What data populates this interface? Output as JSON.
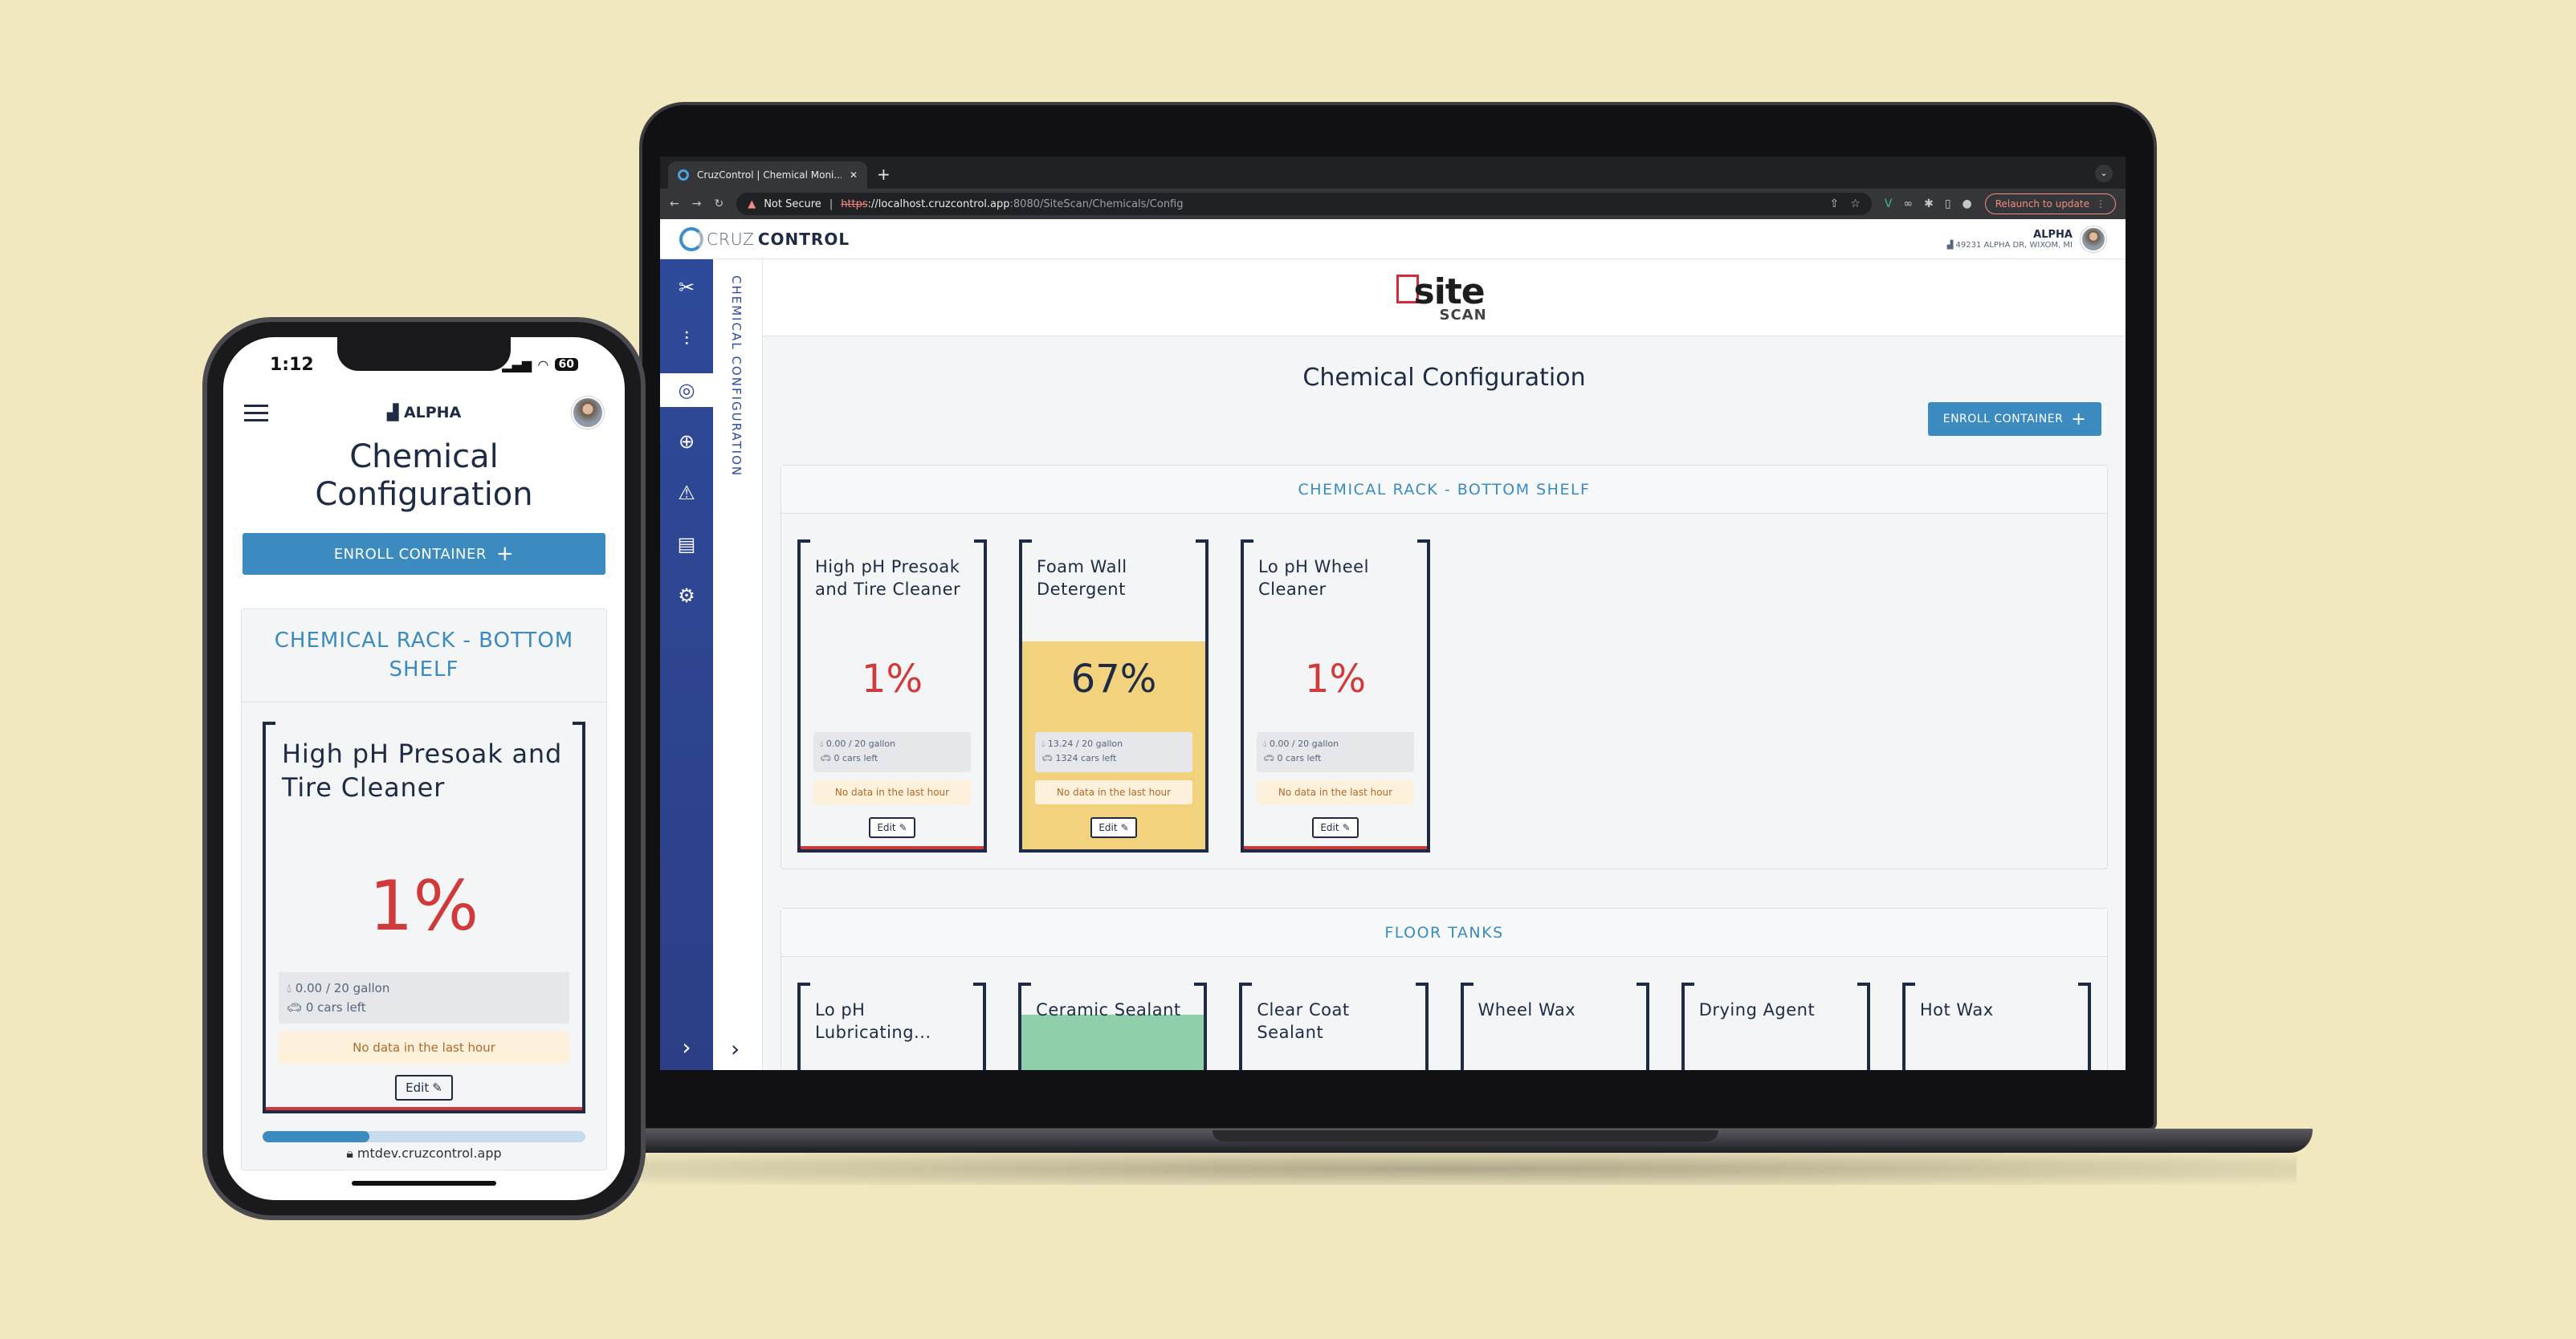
{
  "browser": {
    "tab_title": "CruzControl | Chemical Moni...",
    "new_tab": "+",
    "security": "Not Secure",
    "url_scheme": "https",
    "url_host": "://localhost.cruzcontrol.app",
    "url_path": ":8080/SiteScan/Chemicals/Config",
    "relaunch": "Relaunch to update"
  },
  "header": {
    "logo_thin": "CRUZ",
    "logo_bold": "CONTROL",
    "site_name": "ALPHA",
    "address": "49231 ALPHA DR, WIXOM, MI"
  },
  "subnav_label": "CHEMICAL CONFIGURATION",
  "brand": {
    "word1": "site",
    "word2": "SCAN"
  },
  "page": {
    "title": "Chemical Configuration",
    "enroll_label": "ENROLL CONTAINER",
    "enroll_icon": "+"
  },
  "rack": {
    "title": "CHEMICAL RACK - BOTTOM SHELF",
    "cards": [
      {
        "name": "High pH Presoak and Tire Cleaner",
        "percent": "1%",
        "fill": 0.01,
        "gallons": "0.00 / 20 gallon",
        "cars": "0 cars left",
        "status": "No data in the last hour",
        "edit": "Edit"
      },
      {
        "name": "Foam Wall Detergent",
        "percent": "67%",
        "fill": 0.67,
        "gallons": "13.24 / 20 gallon",
        "cars": "1324 cars left",
        "status": "No data in the last hour",
        "edit": "Edit",
        "color": "#f2d27c"
      },
      {
        "name": "Lo pH Wheel Cleaner",
        "percent": "1%",
        "fill": 0.01,
        "gallons": "0.00 / 20 gallon",
        "cars": "0 cars left",
        "status": "No data in the last hour",
        "edit": "Edit"
      }
    ]
  },
  "floor": {
    "title": "FLOOR TANKS",
    "cards": [
      {
        "name": "Lo pH Lubricating..."
      },
      {
        "name": "Ceramic Sealant",
        "color": "#8fcfaa"
      },
      {
        "name": "Clear Coat Sealant"
      },
      {
        "name": "Wheel Wax"
      },
      {
        "name": "Drying Agent"
      },
      {
        "name": "Hot Wax"
      }
    ]
  },
  "phone": {
    "time": "1:12",
    "battery": "60",
    "location": "ALPHA",
    "title_line1": "Chemical",
    "title_line2": "Configuration",
    "enroll_label": "ENROLL CONTAINER",
    "enroll_icon": "+",
    "section_title": "CHEMICAL RACK - BOTTOM SHELF",
    "card": {
      "name": "High pH Presoak and Tire Cleaner",
      "percent": "1%",
      "gallons": "0.00 / 20 gallon",
      "cars": "0 cars left",
      "status": "No data in the last hour",
      "edit": "Edit"
    },
    "scroll_progress": 0.33,
    "url": "mtdev.cruzcontrol.app"
  },
  "colors": {
    "accent": "#3b8bc0",
    "nav": "#2f4a9a",
    "danger": "#d13a3a",
    "ink": "#1d2b44"
  },
  "icons": [
    "tools-icon",
    "sliders-icon",
    "radar-icon",
    "globe-gear-icon",
    "warning-icon",
    "report-icon",
    "gears-icon",
    "chevron-right-icon"
  ]
}
